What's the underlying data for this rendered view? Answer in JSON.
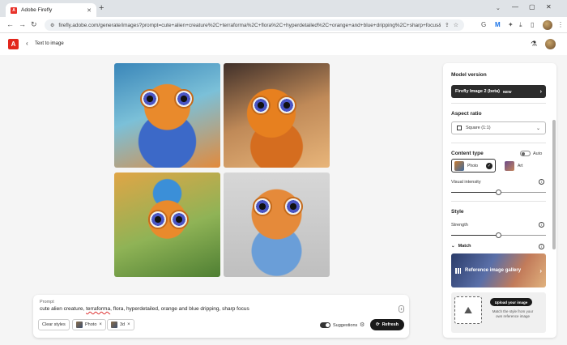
{
  "browser": {
    "tab_title": "Adobe Firefly",
    "tab_favicon": "A",
    "url": "firefly.adobe.com/generate/images?prompt=cute+alien+creature%2C+terraforma%2C+flora%2C+hyperdetailed%2C+orange+and+blue+dripping%2C+sharp+focus&..."
  },
  "header": {
    "logo": "A",
    "back_label": "Text to image"
  },
  "prompt": {
    "label": "Prompt",
    "text_before": "cute alien creature, ",
    "text_underlined": "terraforma",
    "text_after": ", flora, hyperdetailed, orange and blue dripping, sharp focus",
    "clear_styles": "Clear styles",
    "chip_photo": "Photo",
    "chip_3d": "3d",
    "suggestions_label": "Suggestions",
    "suggestions_on": true,
    "refresh_label": "Refresh"
  },
  "panel": {
    "model_version_title": "Model version",
    "model_name": "Firefly Image 2 (beta)",
    "model_badge": "NEW",
    "aspect_ratio_title": "Aspect ratio",
    "aspect_ratio_value": "Square (1:1)",
    "content_type_title": "Content type",
    "auto_label": "Auto",
    "content_type_photo": "Photo",
    "content_type_art": "Art",
    "visual_intensity_label": "Visual intensity",
    "visual_intensity_value": 0.5,
    "style_title": "Style",
    "strength_label": "Strength",
    "strength_value": 0.5,
    "match_label": "Match",
    "reference_gallery_label": "Reference image gallery",
    "upload_button": "Upload your image",
    "upload_desc": "Match the style from your own reference image"
  },
  "icons": {
    "back": "chevron-left-icon",
    "flask": "flask-icon",
    "refresh": "refresh-icon"
  }
}
